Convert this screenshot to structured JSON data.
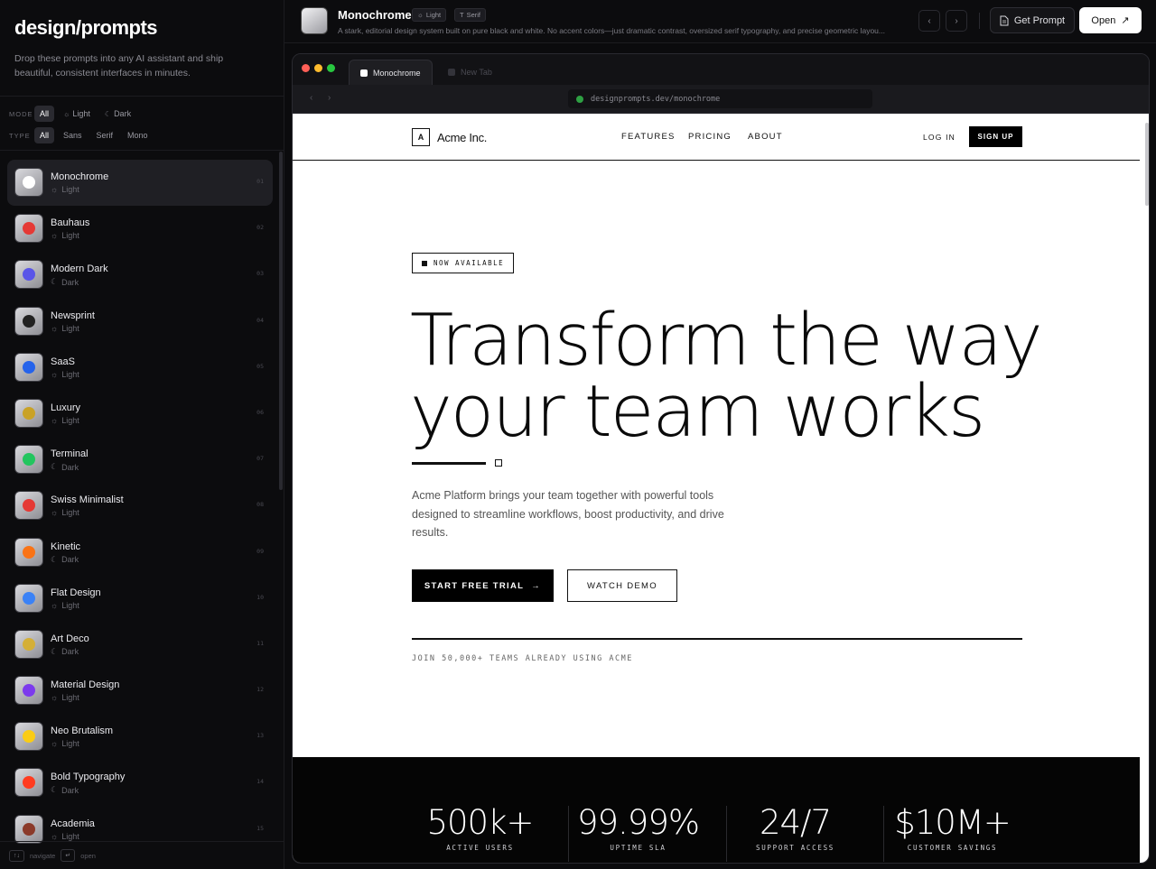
{
  "sidebar": {
    "brand": "design/prompts",
    "tagline": "Drop these prompts into any AI assistant and ship beautiful, consistent interfaces in minutes.",
    "mode_filter": {
      "label": "MODE",
      "options": [
        "All",
        "Light",
        "Dark"
      ],
      "selected": "All"
    },
    "type_filter": {
      "label": "TYPE",
      "options": [
        "All",
        "Sans",
        "Serif",
        "Mono"
      ],
      "selected": "All"
    },
    "themes": [
      {
        "name": "Monochrome",
        "mode": "Light",
        "num": "01",
        "color": "#ffffff",
        "selected": true
      },
      {
        "name": "Bauhaus",
        "mode": "Light",
        "num": "02",
        "color": "#e53935"
      },
      {
        "name": "Modern Dark",
        "mode": "Dark",
        "num": "03",
        "color": "#5a55e8"
      },
      {
        "name": "Newsprint",
        "mode": "Light",
        "num": "04",
        "color": "#222222"
      },
      {
        "name": "SaaS",
        "mode": "Light",
        "num": "05",
        "color": "#2563eb"
      },
      {
        "name": "Luxury",
        "mode": "Light",
        "num": "06",
        "color": "#c9a227"
      },
      {
        "name": "Terminal",
        "mode": "Dark",
        "num": "07",
        "color": "#22c55e"
      },
      {
        "name": "Swiss Minimalist",
        "mode": "Light",
        "num": "08",
        "color": "#e53935"
      },
      {
        "name": "Kinetic",
        "mode": "Dark",
        "num": "09",
        "color": "#f97316"
      },
      {
        "name": "Flat Design",
        "mode": "Light",
        "num": "10",
        "color": "#3b82f6"
      },
      {
        "name": "Art Deco",
        "mode": "Dark",
        "num": "11",
        "color": "#d4af37"
      },
      {
        "name": "Material Design",
        "mode": "Light",
        "num": "12",
        "color": "#7c3aed"
      },
      {
        "name": "Neo Brutalism",
        "mode": "Light",
        "num": "13",
        "color": "#facc15"
      },
      {
        "name": "Bold Typography",
        "mode": "Dark",
        "num": "14",
        "color": "#ff3b1f"
      },
      {
        "name": "Academia",
        "mode": "Light",
        "num": "15",
        "color": "#8b3a2a"
      }
    ],
    "footer": {
      "nav_key": "↑↓",
      "nav_label": "navigate",
      "open_key": "↵",
      "open_label": "open"
    }
  },
  "topbar": {
    "title": "Monochrome",
    "badge_mode": "Light",
    "badge_type": "Serif",
    "description": "A stark, editorial design system built on pure black and white. No accent colors—just dramatic contrast, oversized serif typography, and precise geometric layou...",
    "get_prompt": "Get Prompt",
    "open": "Open"
  },
  "browser": {
    "active_tab": "Monochrome",
    "inactive_tab": "New Tab",
    "url": "designprompts.dev/monochrome"
  },
  "site": {
    "logo_mark": "A",
    "logo_text": "Acme Inc.",
    "nav": [
      "FEATURES",
      "PRICING",
      "ABOUT"
    ],
    "login": "LOG IN",
    "signup": "SIGN UP",
    "badge": "NOW AVAILABLE",
    "hero_line1": "Transform the way",
    "hero_line2": "your team works",
    "subtitle": "Acme Platform brings your team together with powerful tools designed to streamline workflows, boost productivity, and drive results.",
    "cta_primary": "START FREE TRIAL",
    "cta_secondary": "WATCH DEMO",
    "social_proof": "JOIN 50,000+ TEAMS ALREADY USING ACME",
    "stats": [
      {
        "value": "500k+",
        "label": "ACTIVE USERS"
      },
      {
        "value": "99.99%",
        "label": "UPTIME SLA"
      },
      {
        "value": "24/7",
        "label": "SUPPORT ACCESS"
      },
      {
        "value": "$10M+",
        "label": "CUSTOMER SAVINGS"
      }
    ]
  }
}
